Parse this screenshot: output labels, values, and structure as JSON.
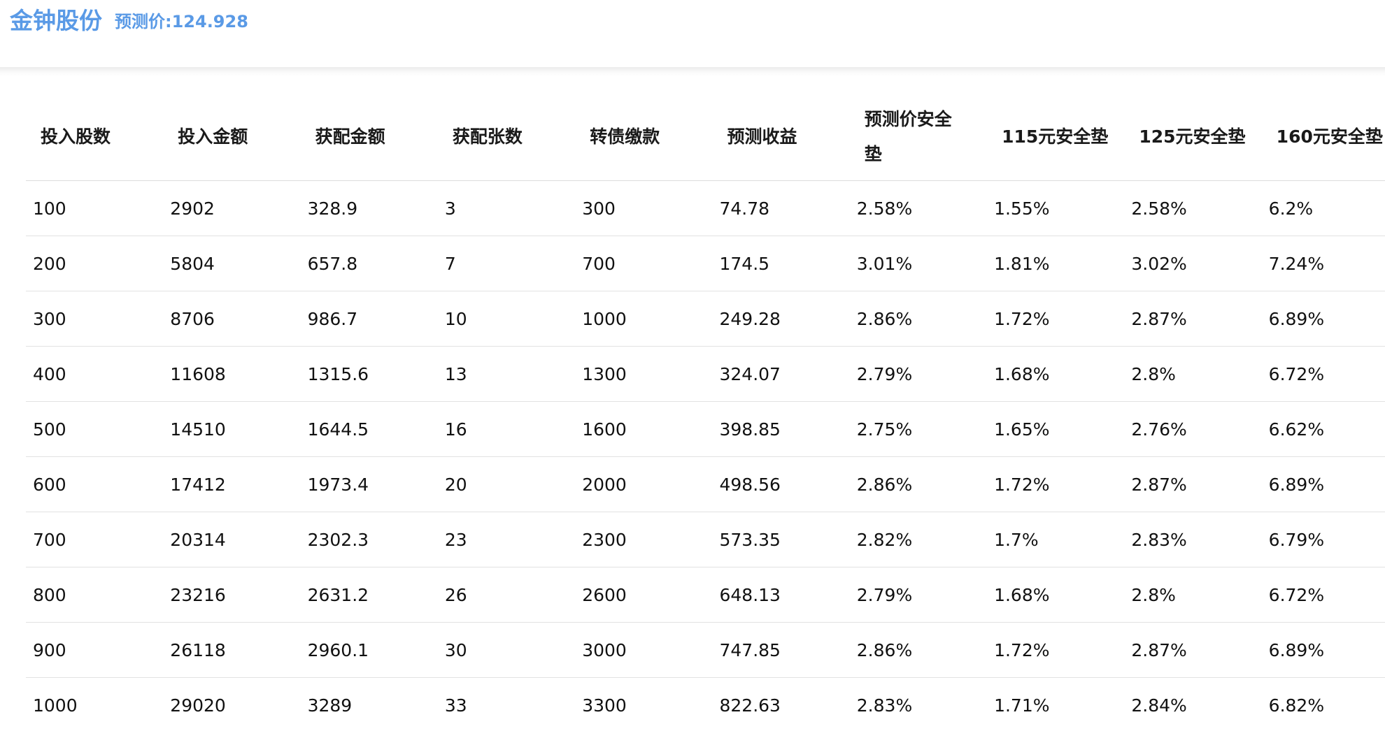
{
  "header": {
    "title": "金钟股份",
    "subtitle": "预测价:124.928"
  },
  "table": {
    "columns": [
      "投入股数",
      "投入金额",
      "获配金额",
      "获配张数",
      "转债缴款",
      "预测收益",
      "预测价安全垫",
      "115元安全垫",
      "125元安全垫",
      "160元安全垫"
    ],
    "rows": [
      [
        "100",
        "2902",
        "328.9",
        "3",
        "300",
        "74.78",
        "2.58%",
        "1.55%",
        "2.58%",
        "6.2%"
      ],
      [
        "200",
        "5804",
        "657.8",
        "7",
        "700",
        "174.5",
        "3.01%",
        "1.81%",
        "3.02%",
        "7.24%"
      ],
      [
        "300",
        "8706",
        "986.7",
        "10",
        "1000",
        "249.28",
        "2.86%",
        "1.72%",
        "2.87%",
        "6.89%"
      ],
      [
        "400",
        "11608",
        "1315.6",
        "13",
        "1300",
        "324.07",
        "2.79%",
        "1.68%",
        "2.8%",
        "6.72%"
      ],
      [
        "500",
        "14510",
        "1644.5",
        "16",
        "1600",
        "398.85",
        "2.75%",
        "1.65%",
        "2.76%",
        "6.62%"
      ],
      [
        "600",
        "17412",
        "1973.4",
        "20",
        "2000",
        "498.56",
        "2.86%",
        "1.72%",
        "2.87%",
        "6.89%"
      ],
      [
        "700",
        "20314",
        "2302.3",
        "23",
        "2300",
        "573.35",
        "2.82%",
        "1.7%",
        "2.83%",
        "6.79%"
      ],
      [
        "800",
        "23216",
        "2631.2",
        "26",
        "2600",
        "648.13",
        "2.79%",
        "1.68%",
        "2.8%",
        "6.72%"
      ],
      [
        "900",
        "26118",
        "2960.1",
        "30",
        "3000",
        "747.85",
        "2.86%",
        "1.72%",
        "2.87%",
        "6.89%"
      ],
      [
        "1000",
        "29020",
        "3289",
        "33",
        "3300",
        "822.63",
        "2.83%",
        "1.71%",
        "2.84%",
        "6.82%"
      ]
    ]
  },
  "colors": {
    "accent": "#5a9ae6",
    "text": "#111111",
    "rule": "#e2e2e2"
  }
}
